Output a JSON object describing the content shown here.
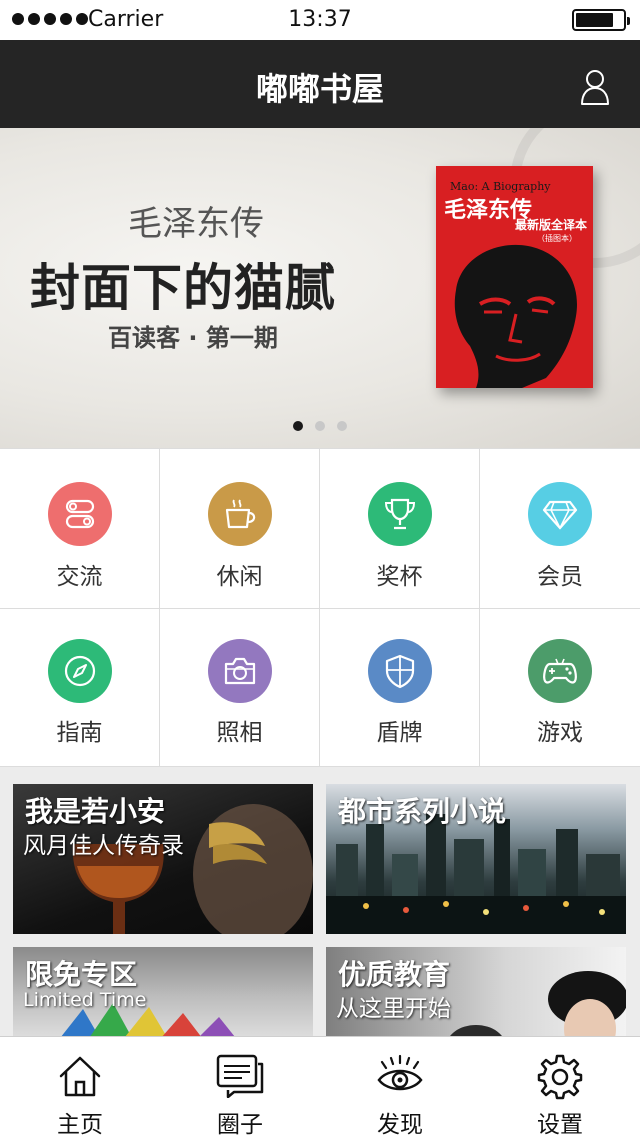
{
  "status_bar": {
    "carrier": "Carrier",
    "time": "13:37",
    "battery_level": 0.8
  },
  "navbar": {
    "title": "嘟嘟书屋",
    "user_icon": "user-icon"
  },
  "banner": {
    "subtitle": "毛泽东传",
    "headline": "封面下的猫腻",
    "issue": "百读客 · 第一期",
    "book": {
      "title_en": "Mao: A Biography",
      "title_cn": "毛泽东传",
      "edition": "最新版全译本",
      "edition_note": "（插图本）"
    },
    "active_slide": 0,
    "slide_count": 3
  },
  "menu": [
    {
      "label": "交流",
      "icon": "toggle-icon",
      "color": "#ee6e6e"
    },
    {
      "label": "休闲",
      "icon": "coffee-icon",
      "color": "#c99a48"
    },
    {
      "label": "奖杯",
      "icon": "trophy-icon",
      "color": "#2dba78"
    },
    {
      "label": "会员",
      "icon": "diamond-icon",
      "color": "#57cee4"
    },
    {
      "label": "指南",
      "icon": "compass-icon",
      "color": "#2dba78"
    },
    {
      "label": "照相",
      "icon": "camera-icon",
      "color": "#9378bf"
    },
    {
      "label": "盾牌",
      "icon": "shield-icon",
      "color": "#5a8ac6"
    },
    {
      "label": "游戏",
      "icon": "gamepad-icon",
      "color": "#4c9c6a"
    }
  ],
  "promos": [
    {
      "title": "我是若小安",
      "subtitle": "风月佳人传奇录"
    },
    {
      "title": "都市系列小说",
      "subtitle": ""
    },
    {
      "title": "限免专区",
      "subtitle": "Limited Time"
    },
    {
      "title": "优质教育",
      "subtitle": "从这里开始"
    }
  ],
  "tabs": [
    {
      "label": "主页",
      "icon": "home-icon"
    },
    {
      "label": "圈子",
      "icon": "chat-icon"
    },
    {
      "label": "发现",
      "icon": "eye-icon"
    },
    {
      "label": "设置",
      "icon": "gear-icon"
    }
  ]
}
